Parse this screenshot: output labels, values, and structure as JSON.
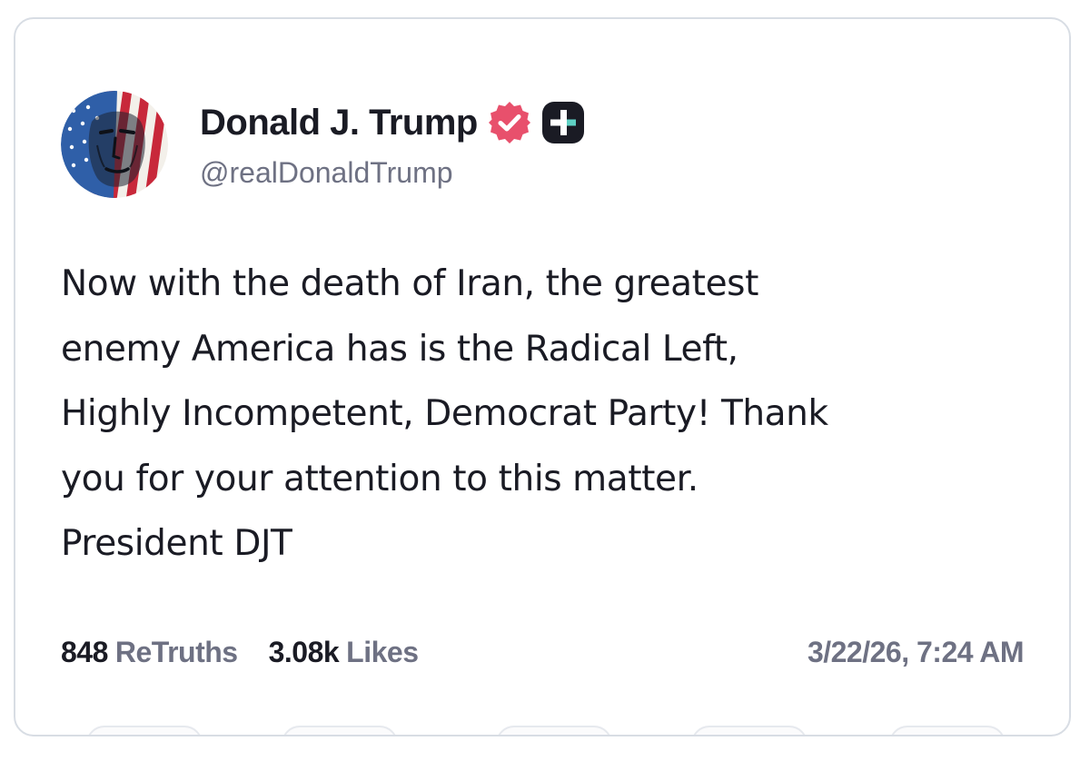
{
  "post": {
    "author": {
      "display_name": "Donald J. Trump",
      "handle": "@realDonaldTrump",
      "avatar_icon": "flag-portrait-avatar",
      "verified_icon": "verified-badge-icon",
      "plus_icon": "truth-plus-icon"
    },
    "body_lines": [
      "Now with the death of Iran, the greatest",
      "enemy America has is the Radical Left,",
      "Highly Incompetent, Democrat Party! Thank",
      "you for your attention to this matter.",
      "President DJT"
    ],
    "stats": {
      "retruths_count": "848",
      "retruths_label": "ReTruths",
      "likes_count": "3.08k",
      "likes_label": "Likes"
    },
    "timestamp": "3/22/26, 7:24 AM"
  },
  "colors": {
    "text_primary": "#1a1b24",
    "text_secondary": "#6e7183",
    "verified_pink": "#e8506c",
    "card_border": "#d8dde4",
    "plus_badge_bg": "#1a1b24",
    "plus_accent": "#5fd1c4"
  }
}
